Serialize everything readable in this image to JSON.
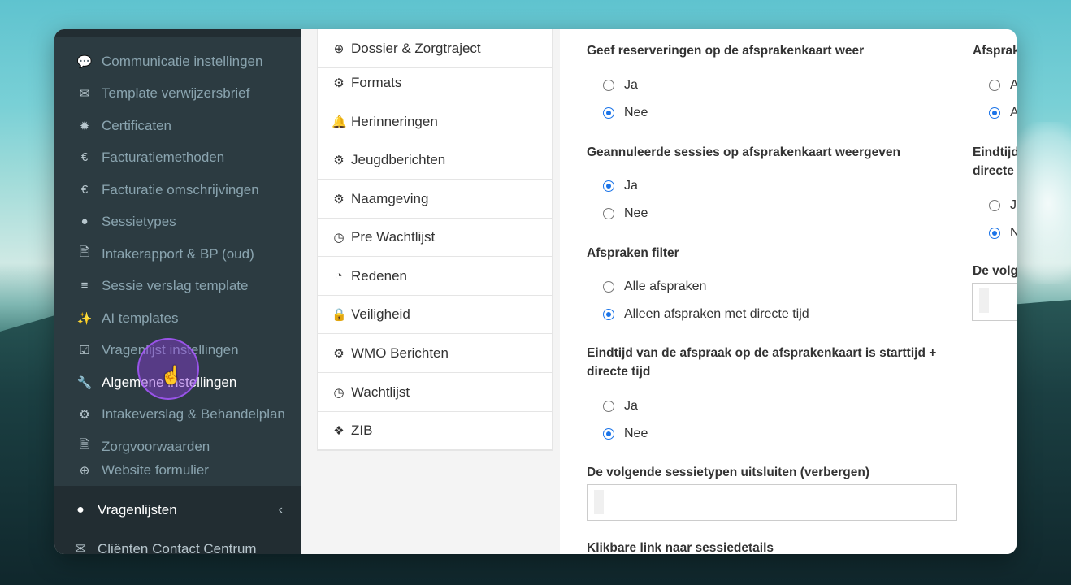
{
  "sidebar": {
    "items": [
      {
        "icon": "comments-icon",
        "glyph": "💬",
        "label": "Communicatie instellingen"
      },
      {
        "icon": "envelope-icon",
        "glyph": "✉",
        "label": "Template verwijzersbrief"
      },
      {
        "icon": "certificate-icon",
        "glyph": "✹",
        "label": "Certificaten"
      },
      {
        "icon": "euro-icon",
        "glyph": "€",
        "label": "Facturatiemethoden"
      },
      {
        "icon": "euro-icon",
        "glyph": "€",
        "label": "Facturatie omschrijvingen"
      },
      {
        "icon": "globe-icon",
        "glyph": "●",
        "label": "Sessietypes"
      },
      {
        "icon": "file-icon",
        "glyph": "🖹",
        "label": "Intakerapport & BP (oud)"
      },
      {
        "icon": "list-icon",
        "glyph": "≡",
        "label": "Sessie verslag template"
      },
      {
        "icon": "magic-wand-icon",
        "glyph": "✨",
        "label": "AI templates"
      },
      {
        "icon": "check-square-icon",
        "glyph": "☑",
        "label": "Vragenlijst instellingen"
      },
      {
        "icon": "wrench-icon",
        "glyph": "🔧",
        "label": "Algemene instellingen"
      },
      {
        "icon": "gear-icon",
        "glyph": "⚙",
        "label": "Intakeverslag & Behandelplan"
      },
      {
        "icon": "pdf-file-icon",
        "glyph": "🗎",
        "label": "Zorgvoorwaarden"
      },
      {
        "icon": "medkit-icon",
        "glyph": "⊕",
        "label": "Website formulier"
      }
    ],
    "group": {
      "icon": "globe-icon",
      "glyph": "●",
      "label": "Vragenlijsten",
      "chevron": "‹"
    },
    "cut_item": {
      "icon": "envelope-icon",
      "glyph": "✉",
      "label": "Cliënten Contact Centrum"
    }
  },
  "menu": {
    "items": [
      {
        "icon": "medkit-icon",
        "glyph": "⊕",
        "label": "Dossier & Zorgtraject"
      },
      {
        "icon": "gear-icon",
        "glyph": "⚙",
        "label": "Formats"
      },
      {
        "icon": "bell-icon",
        "glyph": "🔔",
        "label": "Herinneringen"
      },
      {
        "icon": "gear-icon",
        "glyph": "⚙",
        "label": "Jeugdberichten"
      },
      {
        "icon": "gear-icon",
        "glyph": "⚙",
        "label": "Naamgeving"
      },
      {
        "icon": "clock-icon",
        "glyph": "◷",
        "label": "Pre Wachtlijst"
      },
      {
        "icon": "pie-chart-icon",
        "glyph": "◔",
        "label": "Redenen"
      },
      {
        "icon": "lock-icon",
        "glyph": "🔒",
        "label": "Veiligheid"
      },
      {
        "icon": "gear-icon",
        "glyph": "⚙",
        "label": "WMO Berichten"
      },
      {
        "icon": "clock-icon",
        "glyph": "◷",
        "label": "Wachtlijst"
      },
      {
        "icon": "puzzle-icon",
        "glyph": "❖",
        "label": "ZIB"
      }
    ]
  },
  "settings": {
    "q1": {
      "label": "Geef reserveringen op de afsprakenkaart weer",
      "opt1": "Ja",
      "opt2": "Nee",
      "selected": 2
    },
    "q2": {
      "label": "Geannuleerde sessies op afsprakenkaart weergeven",
      "opt1": "Ja",
      "opt2": "Nee",
      "selected": 1
    },
    "q3": {
      "label": "Afspraken filter",
      "opt1": "Alle afspraken",
      "opt2": "Alleen afspraken met directe tijd",
      "selected": 2
    },
    "q4": {
      "label_line1": "Eindtijd van de afspraak op de afsprakenkaart is starttijd +",
      "label_line2": "directe tijd",
      "opt1": "Ja",
      "opt2": "Nee",
      "selected": 2
    },
    "q5": {
      "label": "De volgende sessietypen uitsluiten (verbergen)"
    },
    "q6": {
      "label": "Klikbare link naar sessiedetails"
    },
    "r1": {
      "label": "Afsprak",
      "opt1": "A",
      "opt2": "A",
      "selected": 2
    },
    "r2": {
      "label_line1": "Eindtijd",
      "label_line2": "directe",
      "opt1": "J",
      "opt2": "N",
      "selected": 2
    },
    "r3": {
      "label": "De volg"
    }
  }
}
